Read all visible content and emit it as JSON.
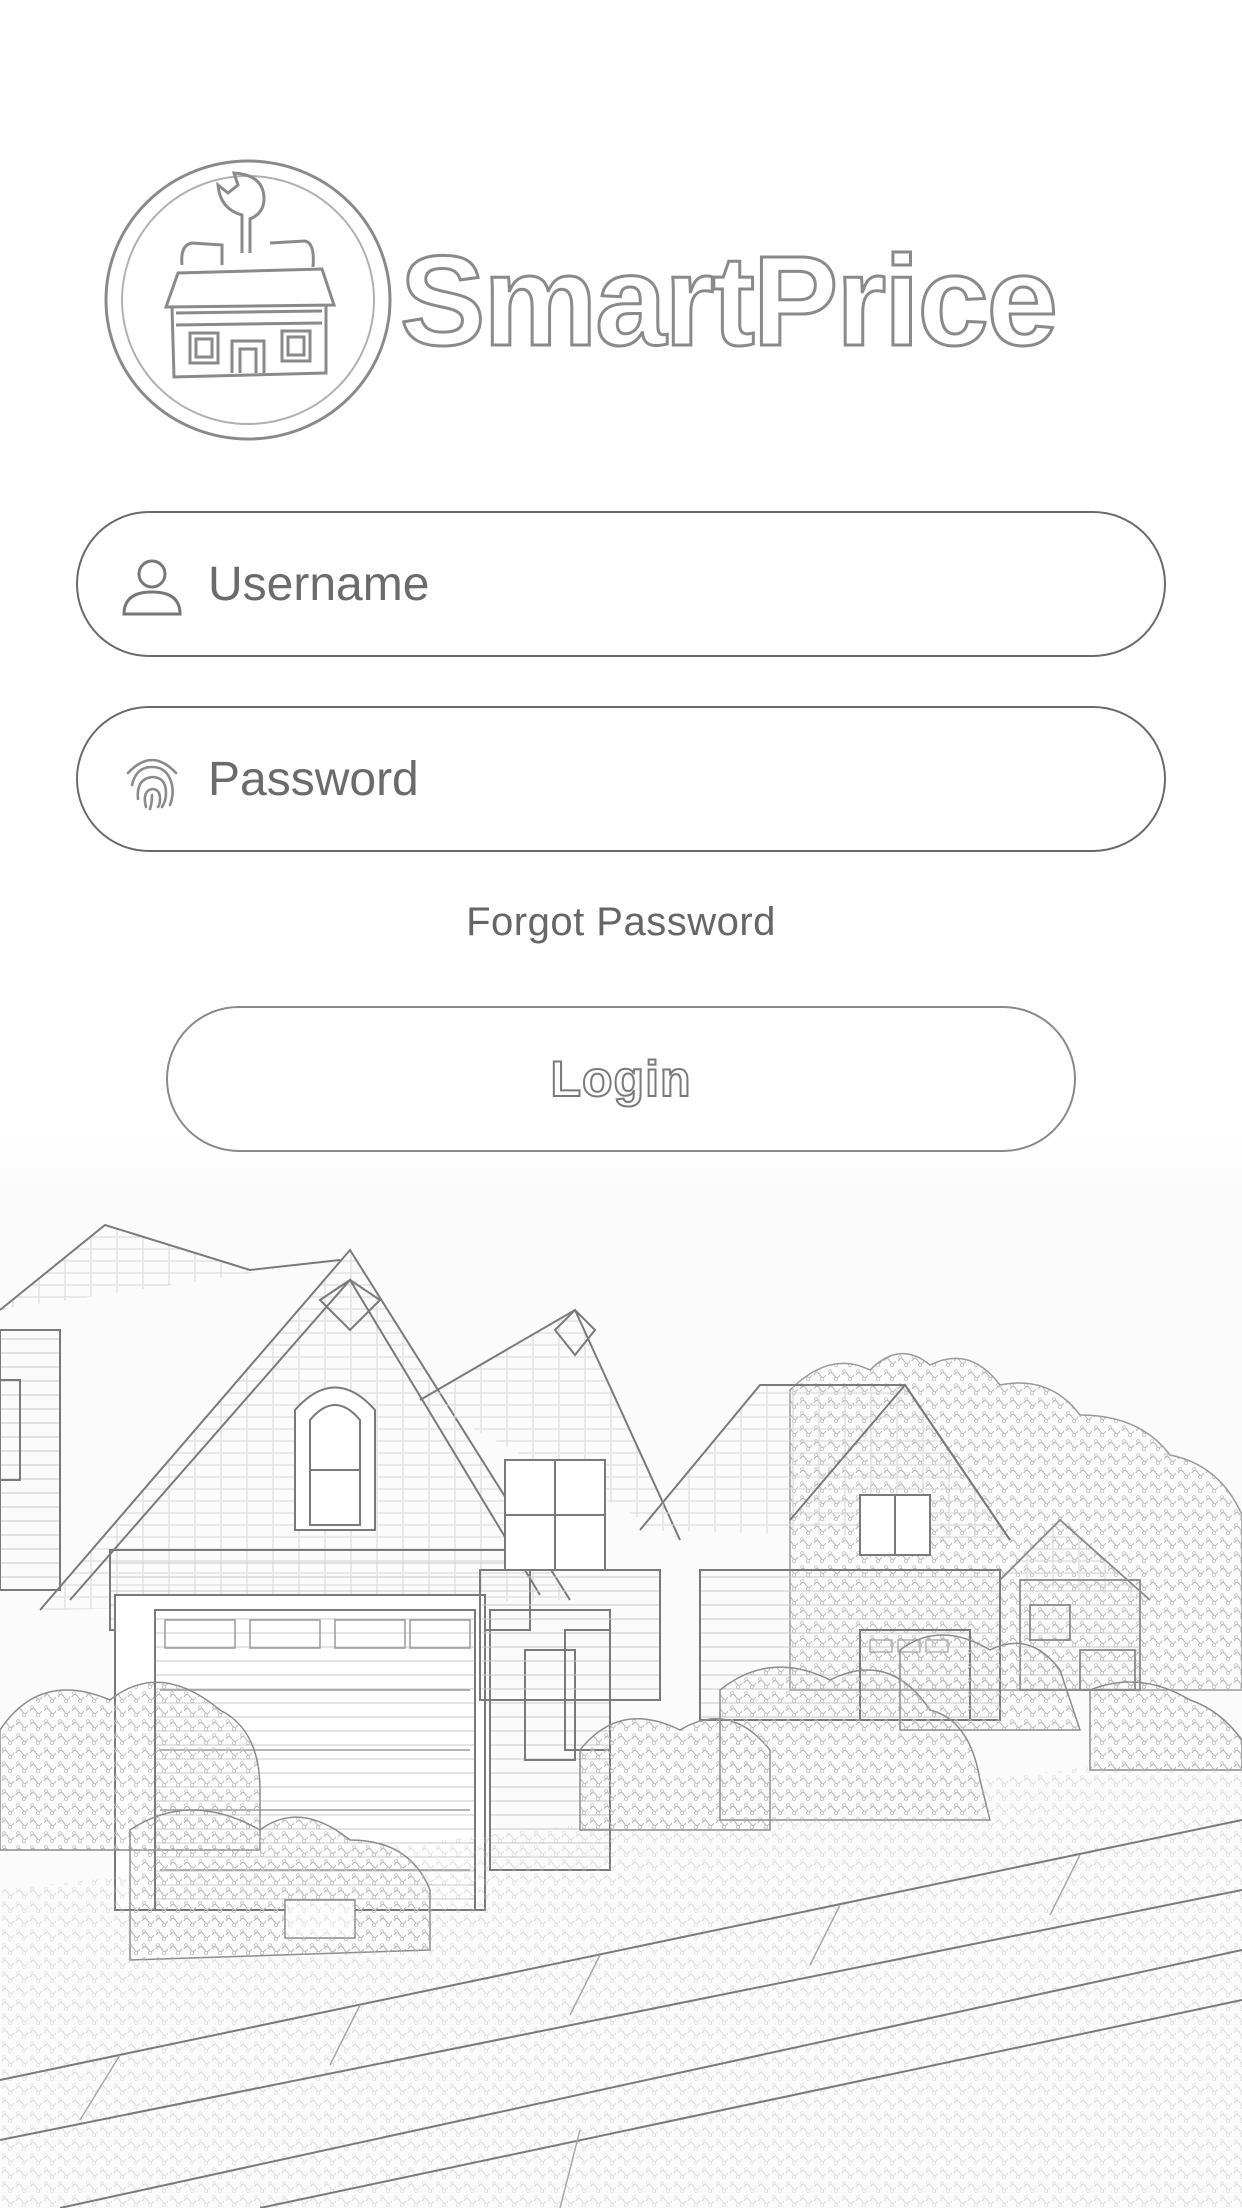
{
  "brand": {
    "name": "SmartPrice",
    "logo_icon": "house-wrench-icon"
  },
  "form": {
    "username": {
      "placeholder": "Username",
      "value": "",
      "icon": "user-icon"
    },
    "password": {
      "placeholder": "Password",
      "value": "",
      "icon": "fingerprint-icon"
    },
    "forgot_label": "Forgot Password",
    "login_label": "Login"
  },
  "background": {
    "subject": "suburban-houses-sketch"
  },
  "colors": {
    "outline": "#6a6a6a",
    "text": "#666666",
    "background": "#ffffff"
  }
}
